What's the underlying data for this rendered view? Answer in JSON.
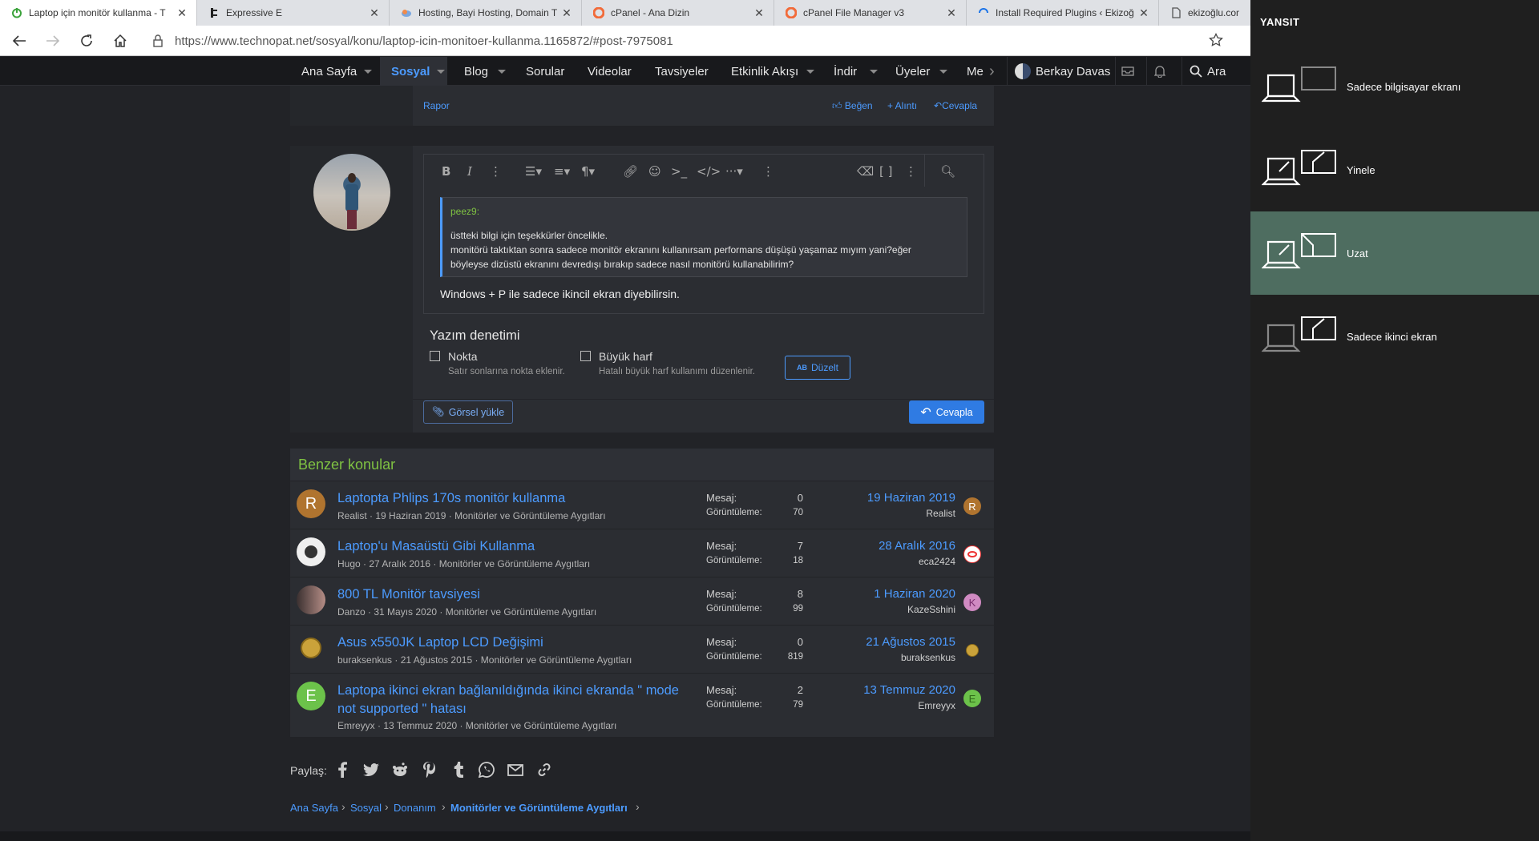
{
  "browser": {
    "tabs": [
      {
        "title": "Laptop için monitör kullanma - T"
      },
      {
        "title": "Expressive E"
      },
      {
        "title": "Hosting, Bayi Hosting, Domain T"
      },
      {
        "title": "cPanel - Ana Dizin"
      },
      {
        "title": "cPanel File Manager v3"
      },
      {
        "title": "Install Required Plugins ‹ Ekizoğ"
      },
      {
        "title": "ekizoğlu.com"
      }
    ],
    "close_glyph": "✕",
    "url": "https://www.technopat.net/sosyal/konu/laptop-icin-monitoer-kullanma.1165872/#post-7975081"
  },
  "nav": {
    "items": [
      "Ana Sayfa",
      "Sosyal",
      "Blog",
      "Sorular",
      "Videolar",
      "Tavsiyeler",
      "Etkinlik Akışı",
      "İndir",
      "Üyeler",
      "Me"
    ],
    "user": "Berkay Davas",
    "search": "Ara"
  },
  "post_actions": {
    "report": "Rapor",
    "like": "Beğen",
    "quote": "+ Alıntı",
    "reply": "Cevapla"
  },
  "editor": {
    "quote_author": "peez9:",
    "quote_lines": [
      "üstteki bilgi için teşekkürler öncelikle.",
      "monitörü taktıktan sonra sadece monitör ekranını kullanırsam performans düşüşü yaşamaz mıyım yani?eğer",
      "böyleyse dizüstü ekranını devredışı bırakıp sadece nasıl monitörü kullanabilirim?"
    ],
    "message": "Windows + P ile sadece ikincil ekran diyebilirsin."
  },
  "spellcheck": {
    "title": "Yazım denetimi",
    "opt1_label": "Nokta",
    "opt1_desc": "Satır sonlarına nokta eklenir.",
    "opt2_label": "Büyük harf",
    "opt2_desc": "Hatalı büyük harf kullanımı düzenlenir.",
    "fix_button": "Düzelt",
    "fix_badge": "AB"
  },
  "actions": {
    "upload": "Görsel yükle",
    "reply": "Cevapla"
  },
  "similar": {
    "title": "Benzer konular",
    "label_msgs": "Mesaj:",
    "label_views": "Görüntüleme:",
    "rows": [
      {
        "initial": "R",
        "color": "#b0742f",
        "title": "Laptopta Phlips 170s monitör kullanma",
        "meta": "Realist · 19 Haziran 2019 · Monitörler ve Görüntüleme Aygıtları",
        "msgs": "0",
        "views": "70",
        "date": "19 Haziran 2019",
        "user": "Realist",
        "sinitial": "R",
        "scolor": "#b0742f"
      },
      {
        "initial": "",
        "color": "#e8e8e8",
        "title": "Laptop'u Masaüstü Gibi Kullanma",
        "meta": "Hugo · 27 Aralık 2016 · Monitörler ve Görüntüleme Aygıtları",
        "msgs": "7",
        "views": "18",
        "date": "28 Aralık 2016",
        "user": "eca2424",
        "sinitial": "",
        "scolor": "#ffffff"
      },
      {
        "initial": "",
        "color": "#6e5a55",
        "title": "800 TL Monitör tavsiyesi",
        "meta": "Danzo · 31 Mayıs 2020 · Monitörler ve Görüntüleme Aygıtları",
        "msgs": "8",
        "views": "99",
        "date": "1 Haziran 2020",
        "user": "KazeSshini",
        "sinitial": "K",
        "scolor": "#d08ac2"
      },
      {
        "initial": "",
        "color": "#caa23a",
        "title": "Asus x550JK Laptop LCD Değişimi",
        "meta": "buraksenkus · 21 Ağustos 2015 · Monitörler ve Görüntüleme Aygıtları",
        "msgs": "0",
        "views": "819",
        "date": "21 Ağustos 2015",
        "user": "buraksenkus",
        "sinitial": "",
        "scolor": "#caa23a"
      },
      {
        "initial": "E",
        "color": "#6cc24a",
        "title": "Laptopa ikinci ekran bağlanıldığında ikinci ekranda \" mode",
        "title2": "not supported \" hatası",
        "meta": "Emreyyx · 13 Temmuz 2020 · Monitörler ve Görüntüleme Aygıtları",
        "msgs": "2",
        "views": "79",
        "date": "13 Temmuz 2020",
        "user": "Emreyyx",
        "sinitial": "E",
        "scolor": "#6cc24a"
      }
    ]
  },
  "share": {
    "label": "Paylaş:"
  },
  "breadcrumb": [
    "Ana Sayfa",
    "Sosyal",
    "Donanım",
    "Monitörler ve Görüntüleme Aygıtları"
  ],
  "project": {
    "title": "YANSIT",
    "options": [
      "Sadece bilgisayar ekranı",
      "Yinele",
      "Uzat",
      "Sadece ikinci ekran"
    ],
    "selected_index": 2
  },
  "colors": {
    "accent": "#4c9bff",
    "green_title": "#7fc242",
    "selected_mode": "#4e6d60"
  }
}
